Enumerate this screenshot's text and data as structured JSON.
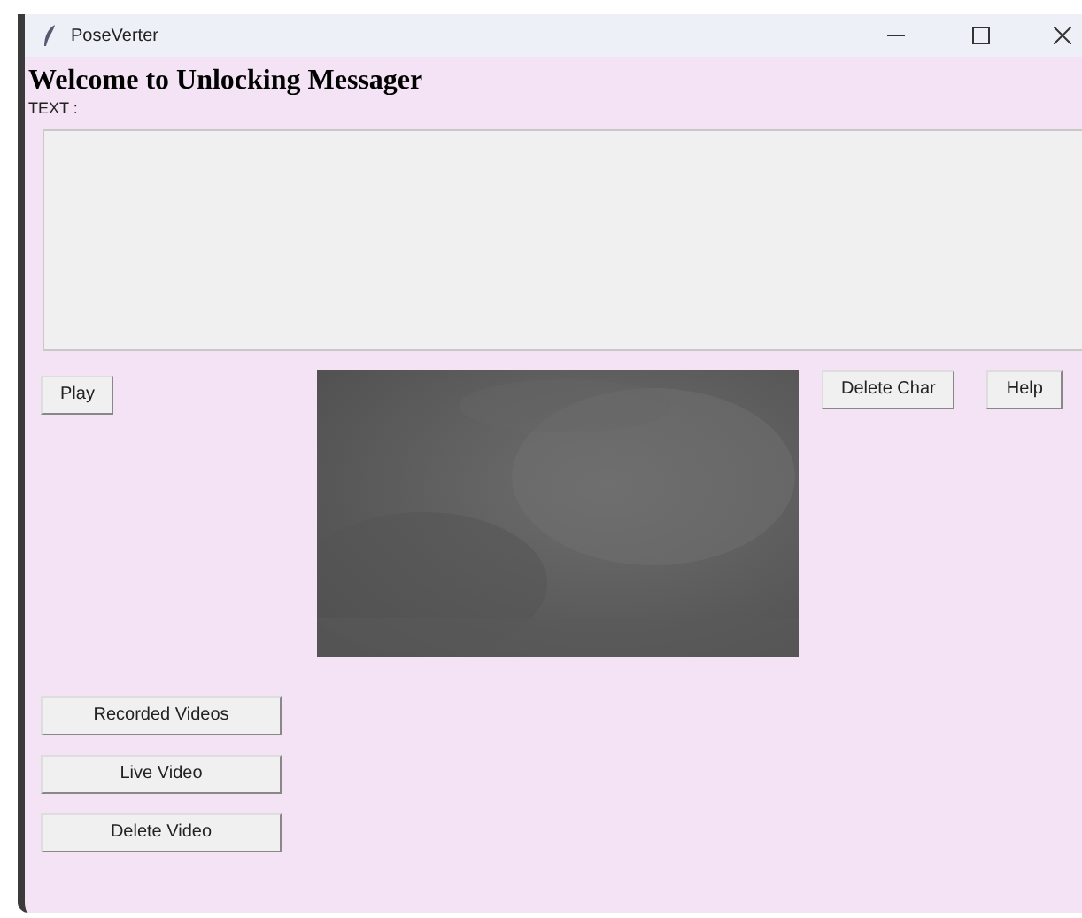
{
  "window": {
    "title": "PoseVerter"
  },
  "heading": "Welcome to Unlocking Messager",
  "text_label": "TEXT :",
  "buttons_top_left": [
    "Play"
  ],
  "buttons_top_right": [
    "Delete Char",
    "Help"
  ],
  "buttons_bottom": [
    "Recorded Videos",
    "Live Video",
    "Delete Video"
  ]
}
